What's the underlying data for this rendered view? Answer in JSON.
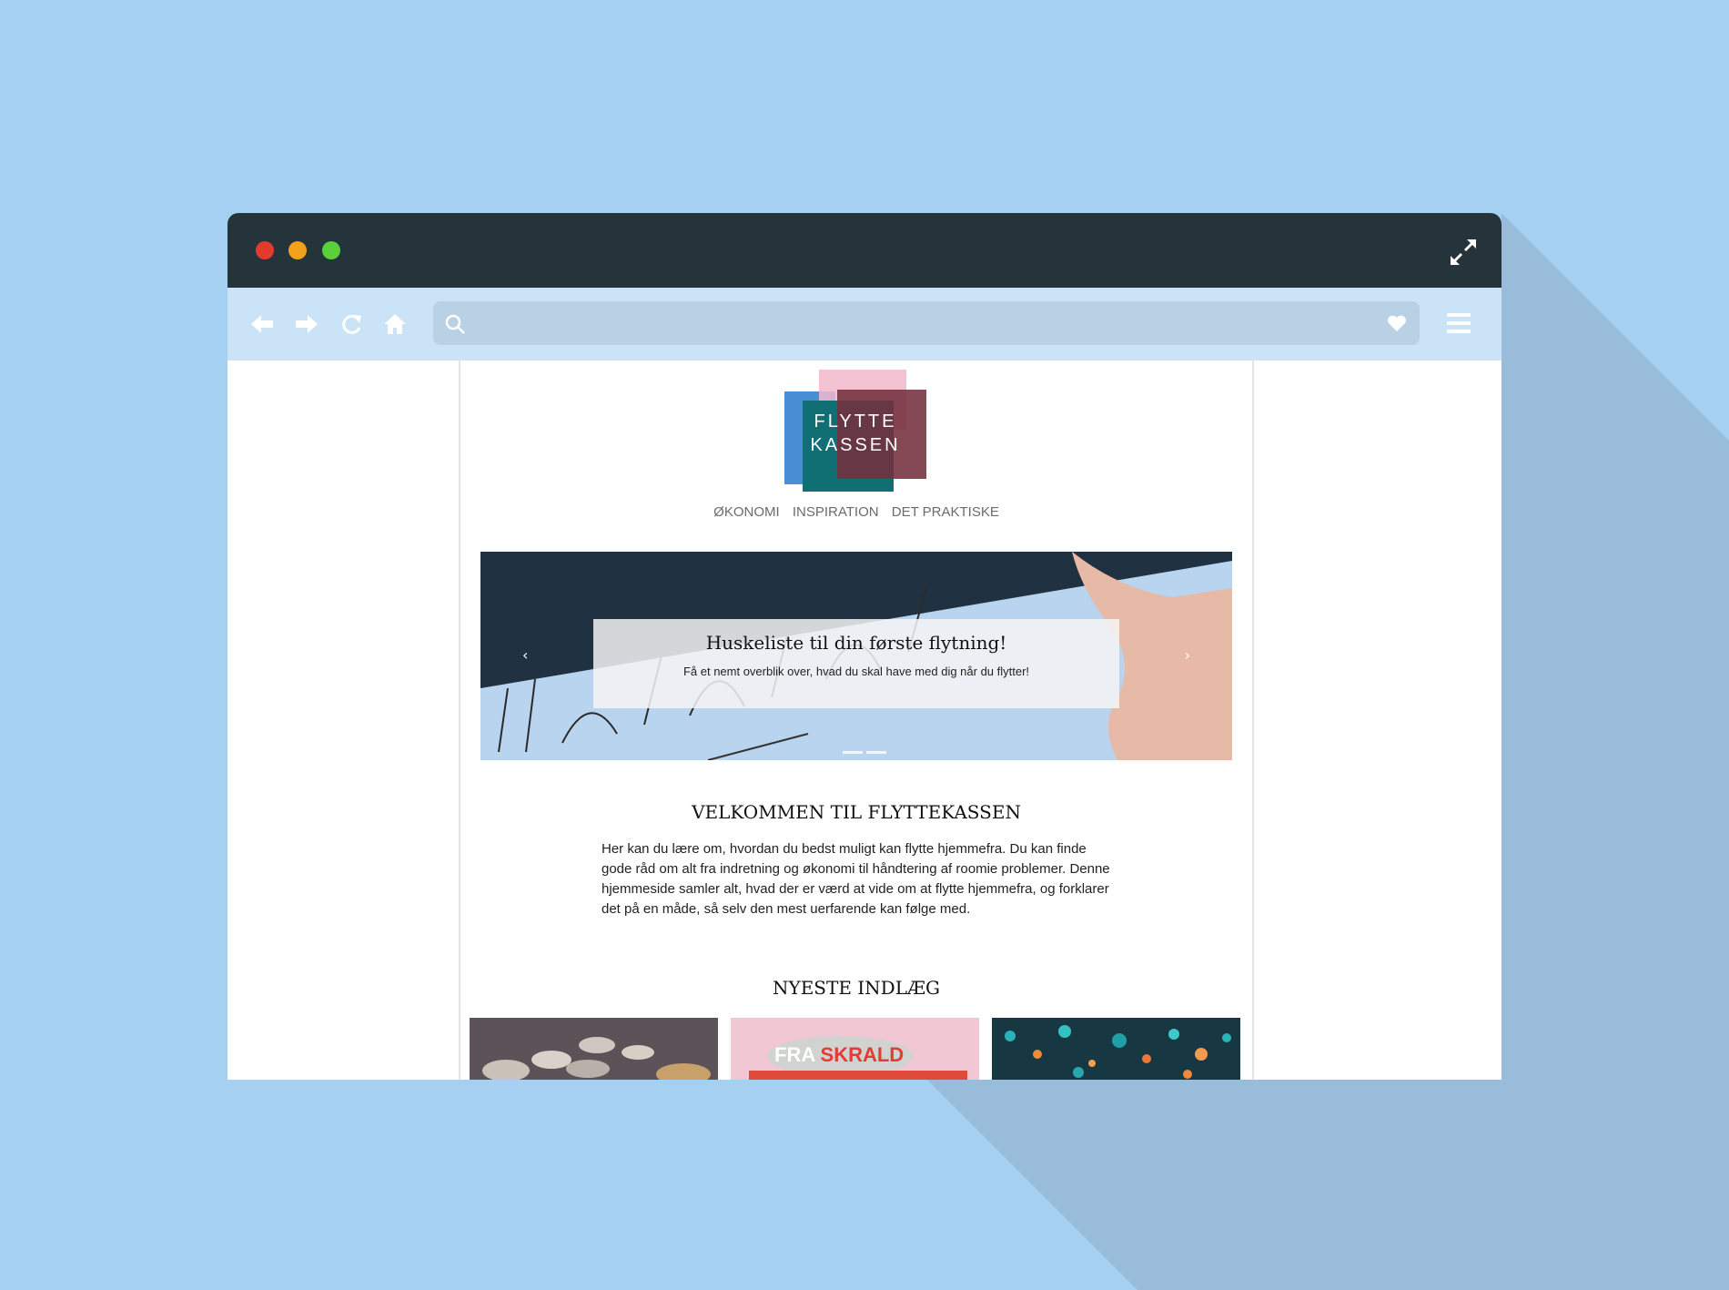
{
  "browser": {
    "window_controls": [
      "close",
      "minimize",
      "maximize"
    ],
    "toolbar_icons": [
      "back-arrow-icon",
      "forward-arrow-icon",
      "reload-icon",
      "home-icon",
      "search-icon",
      "heart-icon",
      "hamburger-menu-icon",
      "expand-icon"
    ],
    "address_bar": {
      "value": ""
    }
  },
  "site": {
    "logo": {
      "line1": "FLYTTE",
      "line2": "KASSEN"
    },
    "nav": [
      {
        "label": "ØKONOMI"
      },
      {
        "label": "INSPIRATION"
      },
      {
        "label": "DET PRAKTISKE"
      }
    ],
    "hero": {
      "title": "Huskeliste til din første flytning!",
      "subtitle": "Få et nemt overblik over, hvad du skal have med dig når du flytter!",
      "prev_arrow": "‹",
      "next_arrow": "›",
      "slide_count": 2
    },
    "welcome": {
      "title": "VELKOMMEN TIL FLYTTEKASSEN",
      "text": "Her kan du lære om, hvordan du bedst muligt kan flytte hjemmefra. Du kan finde gode råd om alt fra indretning og økonomi til håndtering af roomie problemer. Denne hjemmeside samler alt, hvad der er værd at vide om at flytte hjemmefra, og forklarer det på en måde, så selv den mest uerfarende kan følge med."
    },
    "latest": {
      "title": "NYESTE INDLÆG",
      "posts": [
        {
          "image": "coins"
        },
        {
          "image": "poster",
          "text_white": "FRA ",
          "text_red": "SKRALD"
        },
        {
          "image": "bokeh-lights"
        }
      ]
    }
  },
  "colors": {
    "background": "#a6d0f2",
    "titlebar": "#24343a",
    "toolbar": "#cbe3f7",
    "logo_blue": "#4a8fd6",
    "logo_pink": "#f1b9cd",
    "logo_teal": "#0f6f73",
    "logo_maroon": "#74303f"
  }
}
